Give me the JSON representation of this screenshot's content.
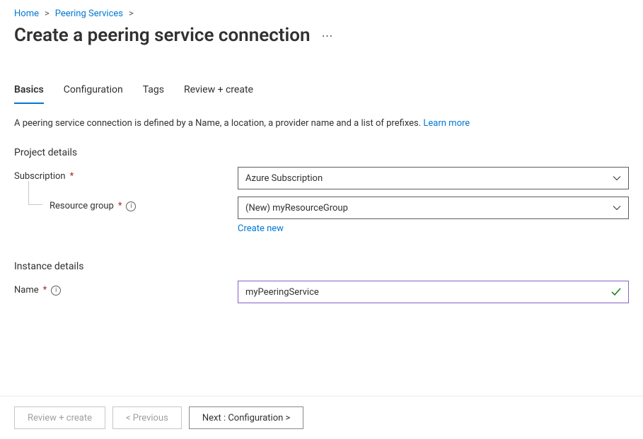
{
  "breadcrumb": {
    "home": "Home",
    "peering_services": "Peering Services"
  },
  "page_title": "Create a peering service connection",
  "tabs": {
    "basics": "Basics",
    "configuration": "Configuration",
    "tags": "Tags",
    "review": "Review + create"
  },
  "description": {
    "text": "A peering service connection is defined by a Name, a location, a provider name and a list of prefixes. ",
    "learn_more": "Learn more"
  },
  "sections": {
    "project_details": "Project details",
    "instance_details": "Instance details"
  },
  "fields": {
    "subscription": {
      "label": "Subscription",
      "value": "Azure Subscription"
    },
    "resource_group": {
      "label": "Resource group",
      "value": "(New) myResourceGroup",
      "create_new": "Create new"
    },
    "name": {
      "label": "Name",
      "value": "myPeeringService"
    }
  },
  "buttons": {
    "review_create": "Review + create",
    "previous": "< Previous",
    "next": "Next : Configuration >"
  }
}
